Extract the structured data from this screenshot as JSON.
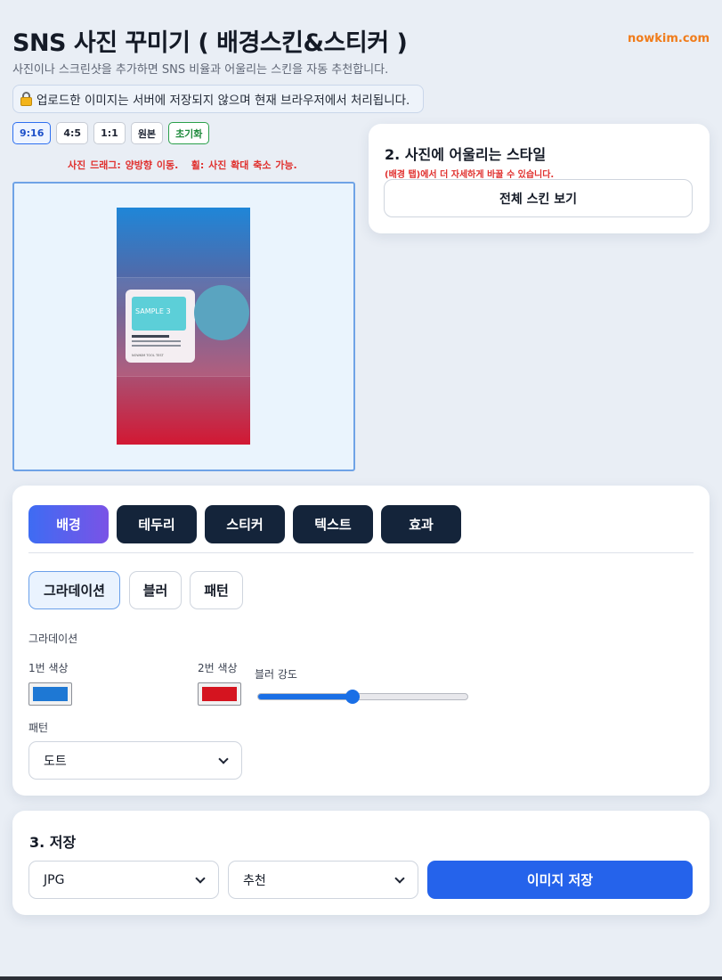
{
  "header": {
    "title": "SNS 사진 꾸미기 ( 배경스킨&스티커 )",
    "brand": "nowkim.com",
    "subtitle": "사진이나 스크린샷을 추가하면 SNS 비율과 어울리는 스킨을 자동 추천합니다.",
    "notice": "업로드한 이미지는 서버에 저장되지 않으며 현재 브라우저에서 처리됩니다."
  },
  "ratio_buttons": [
    "9:16",
    "4:5",
    "1:1",
    "원본"
  ],
  "ratio_selected": "9:16",
  "reset_label": "초기화",
  "canvas": {
    "hint": "사진 드래그: 양방향 이동.   휠: 사진 확대 축소 가능.",
    "sticker_text": "SAMPLE 3",
    "sticker_footer": "NOWKIM TOOL TEST",
    "gradient_start": "#1f86d8",
    "gradient_end": "#d21833"
  },
  "style_panel": {
    "heading": "2. 사진에 어울리는 스타일",
    "note": "(배경 탭)에서 더 자세하게 바꿀 수 있습니다.",
    "button": "전체 스킨 보기"
  },
  "editor": {
    "tabs": [
      "배경",
      "테두리",
      "스티커",
      "텍스트",
      "효과"
    ],
    "active_tab": "배경",
    "subtabs": [
      "그라데이션",
      "블러",
      "패턴"
    ],
    "active_subtab": "그라데이션",
    "section_label": "그라데이션",
    "color1_label": "1번 색상",
    "color1": "#1e78d4",
    "color2_label": "2번 색상",
    "color2": "#d5141f",
    "blur_label": "블러 강도",
    "blur_value": 0.45,
    "pattern_label": "패턴",
    "pattern_value": "도트"
  },
  "save": {
    "heading": "3. 저장",
    "format": "JPG",
    "size": "추천",
    "button": "이미지 저장"
  }
}
